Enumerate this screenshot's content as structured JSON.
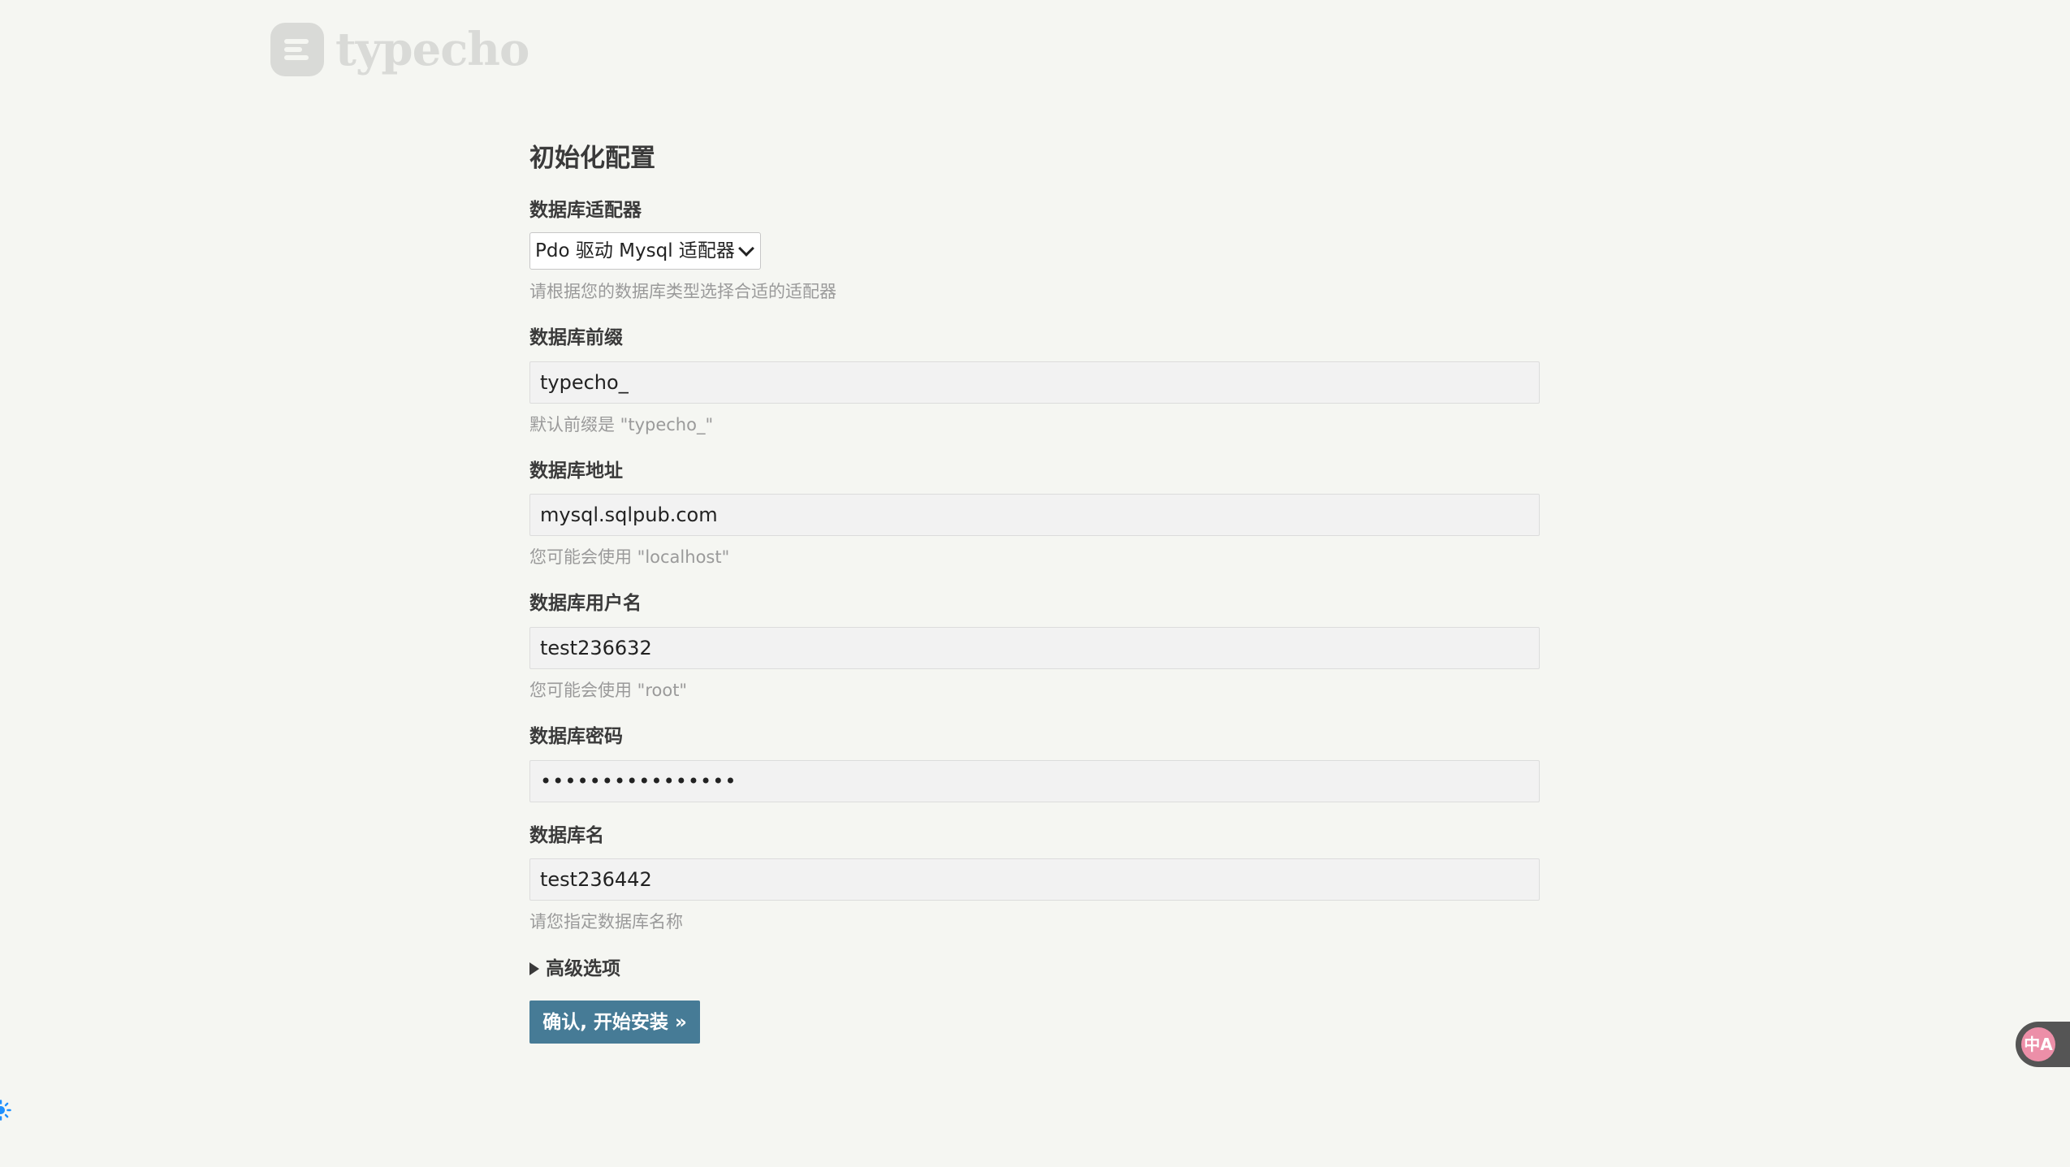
{
  "logo": {
    "text": "typecho"
  },
  "form": {
    "heading": "初始化配置",
    "adapter": {
      "label": "数据库适配器",
      "selected": "Pdo 驱动 Mysql 适配器",
      "hint": "请根据您的数据库类型选择合适的适配器"
    },
    "prefix": {
      "label": "数据库前缀",
      "value": "typecho_",
      "hint": "默认前缀是 \"typecho_\""
    },
    "host": {
      "label": "数据库地址",
      "value": "mysql.sqlpub.com",
      "hint": "您可能会使用 \"localhost\""
    },
    "user": {
      "label": "数据库用户名",
      "value": "test236632",
      "hint": "您可能会使用 \"root\""
    },
    "password": {
      "label": "数据库密码",
      "value": "••••••••••••••••"
    },
    "dbname": {
      "label": "数据库名",
      "value": "test236442",
      "hint": "请您指定数据库名称"
    },
    "advanced_label": "高级选项",
    "submit_label": "确认, 开始安装 »"
  },
  "widgets": {
    "translate_icon": "translate-icon",
    "translate_glyph": "中A",
    "theme_icon": "sun-icon"
  },
  "colors": {
    "background": "#f5f6f2",
    "button": "#467b96",
    "hint": "#9a9a9a",
    "logo": "#d9dad7",
    "translate": "#ec8fa8",
    "sun": "#1e90ff"
  }
}
